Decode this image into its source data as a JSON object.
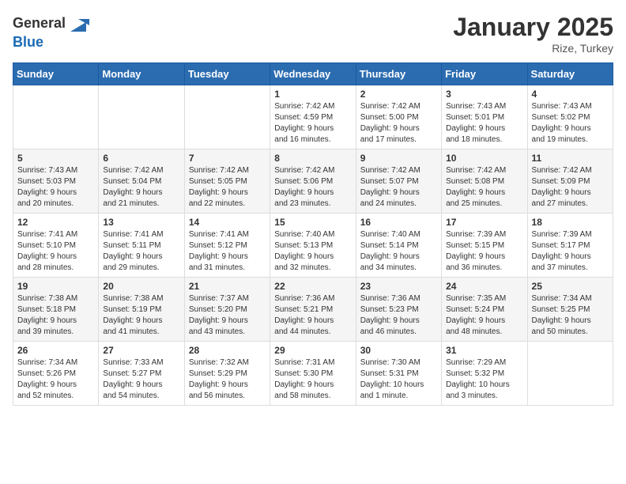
{
  "header": {
    "logo_general": "General",
    "logo_blue": "Blue",
    "month": "January 2025",
    "location": "Rize, Turkey"
  },
  "weekdays": [
    "Sunday",
    "Monday",
    "Tuesday",
    "Wednesday",
    "Thursday",
    "Friday",
    "Saturday"
  ],
  "weeks": [
    [
      {
        "day": "",
        "info": ""
      },
      {
        "day": "",
        "info": ""
      },
      {
        "day": "",
        "info": ""
      },
      {
        "day": "1",
        "info": "Sunrise: 7:42 AM\nSunset: 4:59 PM\nDaylight: 9 hours\nand 16 minutes."
      },
      {
        "day": "2",
        "info": "Sunrise: 7:42 AM\nSunset: 5:00 PM\nDaylight: 9 hours\nand 17 minutes."
      },
      {
        "day": "3",
        "info": "Sunrise: 7:43 AM\nSunset: 5:01 PM\nDaylight: 9 hours\nand 18 minutes."
      },
      {
        "day": "4",
        "info": "Sunrise: 7:43 AM\nSunset: 5:02 PM\nDaylight: 9 hours\nand 19 minutes."
      }
    ],
    [
      {
        "day": "5",
        "info": "Sunrise: 7:43 AM\nSunset: 5:03 PM\nDaylight: 9 hours\nand 20 minutes."
      },
      {
        "day": "6",
        "info": "Sunrise: 7:42 AM\nSunset: 5:04 PM\nDaylight: 9 hours\nand 21 minutes."
      },
      {
        "day": "7",
        "info": "Sunrise: 7:42 AM\nSunset: 5:05 PM\nDaylight: 9 hours\nand 22 minutes."
      },
      {
        "day": "8",
        "info": "Sunrise: 7:42 AM\nSunset: 5:06 PM\nDaylight: 9 hours\nand 23 minutes."
      },
      {
        "day": "9",
        "info": "Sunrise: 7:42 AM\nSunset: 5:07 PM\nDaylight: 9 hours\nand 24 minutes."
      },
      {
        "day": "10",
        "info": "Sunrise: 7:42 AM\nSunset: 5:08 PM\nDaylight: 9 hours\nand 25 minutes."
      },
      {
        "day": "11",
        "info": "Sunrise: 7:42 AM\nSunset: 5:09 PM\nDaylight: 9 hours\nand 27 minutes."
      }
    ],
    [
      {
        "day": "12",
        "info": "Sunrise: 7:41 AM\nSunset: 5:10 PM\nDaylight: 9 hours\nand 28 minutes."
      },
      {
        "day": "13",
        "info": "Sunrise: 7:41 AM\nSunset: 5:11 PM\nDaylight: 9 hours\nand 29 minutes."
      },
      {
        "day": "14",
        "info": "Sunrise: 7:41 AM\nSunset: 5:12 PM\nDaylight: 9 hours\nand 31 minutes."
      },
      {
        "day": "15",
        "info": "Sunrise: 7:40 AM\nSunset: 5:13 PM\nDaylight: 9 hours\nand 32 minutes."
      },
      {
        "day": "16",
        "info": "Sunrise: 7:40 AM\nSunset: 5:14 PM\nDaylight: 9 hours\nand 34 minutes."
      },
      {
        "day": "17",
        "info": "Sunrise: 7:39 AM\nSunset: 5:15 PM\nDaylight: 9 hours\nand 36 minutes."
      },
      {
        "day": "18",
        "info": "Sunrise: 7:39 AM\nSunset: 5:17 PM\nDaylight: 9 hours\nand 37 minutes."
      }
    ],
    [
      {
        "day": "19",
        "info": "Sunrise: 7:38 AM\nSunset: 5:18 PM\nDaylight: 9 hours\nand 39 minutes."
      },
      {
        "day": "20",
        "info": "Sunrise: 7:38 AM\nSunset: 5:19 PM\nDaylight: 9 hours\nand 41 minutes."
      },
      {
        "day": "21",
        "info": "Sunrise: 7:37 AM\nSunset: 5:20 PM\nDaylight: 9 hours\nand 43 minutes."
      },
      {
        "day": "22",
        "info": "Sunrise: 7:36 AM\nSunset: 5:21 PM\nDaylight: 9 hours\nand 44 minutes."
      },
      {
        "day": "23",
        "info": "Sunrise: 7:36 AM\nSunset: 5:23 PM\nDaylight: 9 hours\nand 46 minutes."
      },
      {
        "day": "24",
        "info": "Sunrise: 7:35 AM\nSunset: 5:24 PM\nDaylight: 9 hours\nand 48 minutes."
      },
      {
        "day": "25",
        "info": "Sunrise: 7:34 AM\nSunset: 5:25 PM\nDaylight: 9 hours\nand 50 minutes."
      }
    ],
    [
      {
        "day": "26",
        "info": "Sunrise: 7:34 AM\nSunset: 5:26 PM\nDaylight: 9 hours\nand 52 minutes."
      },
      {
        "day": "27",
        "info": "Sunrise: 7:33 AM\nSunset: 5:27 PM\nDaylight: 9 hours\nand 54 minutes."
      },
      {
        "day": "28",
        "info": "Sunrise: 7:32 AM\nSunset: 5:29 PM\nDaylight: 9 hours\nand 56 minutes."
      },
      {
        "day": "29",
        "info": "Sunrise: 7:31 AM\nSunset: 5:30 PM\nDaylight: 9 hours\nand 58 minutes."
      },
      {
        "day": "30",
        "info": "Sunrise: 7:30 AM\nSunset: 5:31 PM\nDaylight: 10 hours\nand 1 minute."
      },
      {
        "day": "31",
        "info": "Sunrise: 7:29 AM\nSunset: 5:32 PM\nDaylight: 10 hours\nand 3 minutes."
      },
      {
        "day": "",
        "info": ""
      }
    ]
  ]
}
